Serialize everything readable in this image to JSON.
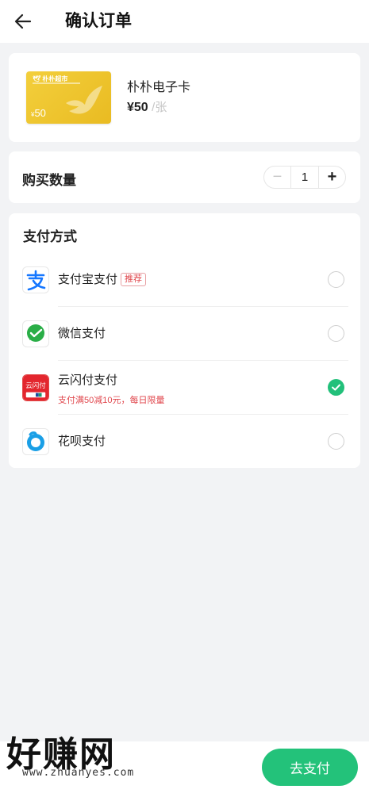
{
  "header": {
    "title": "确认订单",
    "back_icon": "arrow-left-icon"
  },
  "product": {
    "card_brand": "朴朴超市",
    "card_value": "50",
    "card_currency": "¥",
    "name": "朴朴电子卡",
    "price": "¥50",
    "unit": "/张",
    "card_color": "#f0c52f"
  },
  "quantity": {
    "label": "购买数量",
    "minus": "−",
    "value": "1",
    "plus": "+"
  },
  "payment": {
    "title": "支付方式",
    "methods": [
      {
        "name": "支付宝支付",
        "tag": "推荐",
        "promo": "",
        "icon": "alipay-icon",
        "selected": false
      },
      {
        "name": "微信支付",
        "tag": "",
        "promo": "",
        "icon": "wechat-pay-icon",
        "selected": false
      },
      {
        "name": "云闪付支付",
        "tag": "",
        "promo": "支付满50减10元，每日限量",
        "icon": "unionpay-quickpass-icon",
        "selected": true
      },
      {
        "name": "花呗支付",
        "tag": "",
        "promo": "",
        "icon": "huabei-icon",
        "selected": false
      }
    ],
    "unionpay_icon_text": "云闪付"
  },
  "watermark": {
    "big": "好赚网",
    "url": "www.zhuanyes.com"
  },
  "footer": {
    "pay_button": "去支付"
  },
  "colors": {
    "accent": "#23c27a",
    "promo": "#e0464c",
    "background": "#f2f3f5"
  }
}
